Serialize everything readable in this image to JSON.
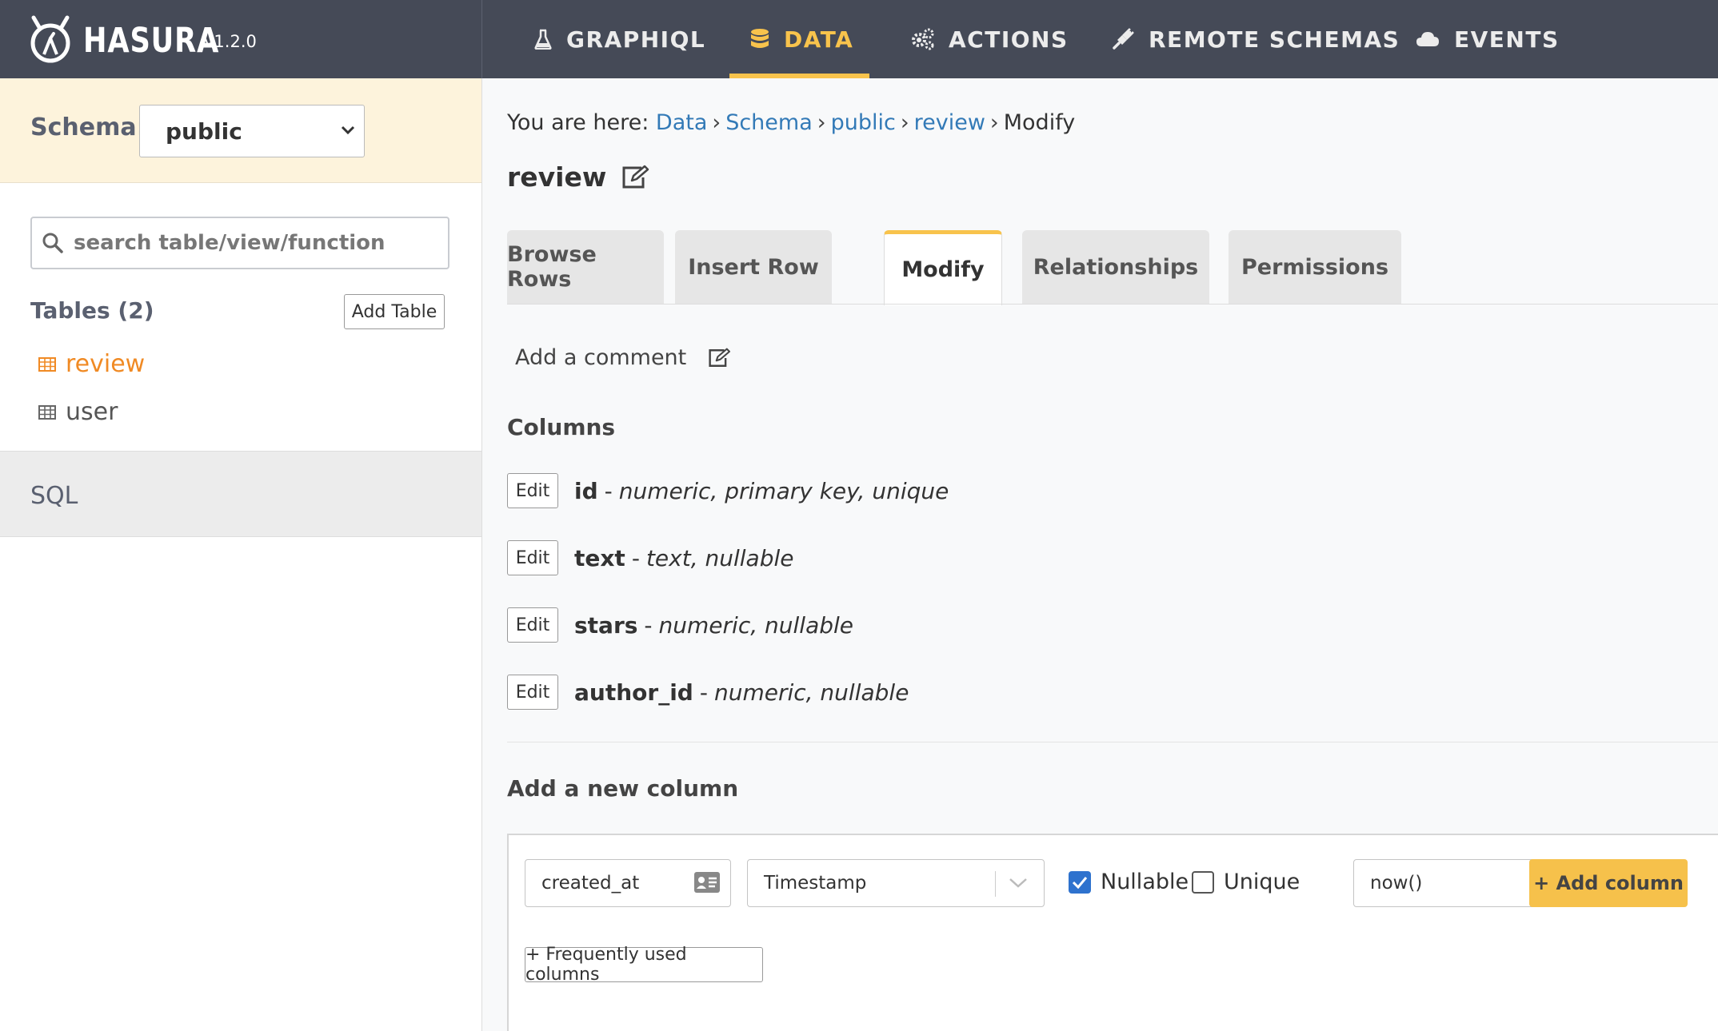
{
  "app": {
    "name": "HASURA",
    "version": "v1.2.0"
  },
  "nav": {
    "items": [
      {
        "label": "GRAPHIQL",
        "icon": "flask-icon"
      },
      {
        "label": "DATA",
        "icon": "database-icon",
        "active": true
      },
      {
        "label": "ACTIONS",
        "icon": "cogs-icon"
      },
      {
        "label": "REMOTE SCHEMAS",
        "icon": "plug-icon"
      },
      {
        "label": "EVENTS",
        "icon": "cloud-icon"
      }
    ]
  },
  "sidebar": {
    "schema_label": "Schema:",
    "schema_value": "public",
    "search_placeholder": "search table/view/function",
    "tables_heading": "Tables (2)",
    "add_table_label": "Add Table",
    "tables": [
      {
        "label": "review",
        "active": true
      },
      {
        "label": "user",
        "active": false
      }
    ],
    "sql_label": "SQL"
  },
  "breadcrumb": {
    "prefix": "You are here:",
    "items": [
      "Data",
      "Schema",
      "public",
      "review",
      "Modify"
    ]
  },
  "page_title": "review",
  "tabs": [
    {
      "label": "Browse Rows"
    },
    {
      "label": "Insert Row"
    },
    {
      "label": "Modify",
      "active": true
    },
    {
      "label": "Relationships"
    },
    {
      "label": "Permissions"
    }
  ],
  "comment_label": "Add a comment",
  "columns_heading": "Columns",
  "columns": [
    {
      "edit": "Edit",
      "name": "id",
      "dash": "-",
      "type": "numeric, primary key, unique"
    },
    {
      "edit": "Edit",
      "name": "text",
      "dash": "-",
      "type": "text, nullable"
    },
    {
      "edit": "Edit",
      "name": "stars",
      "dash": "-",
      "type": "numeric, nullable"
    },
    {
      "edit": "Edit",
      "name": "author_id",
      "dash": "-",
      "type": "numeric, nullable"
    }
  ],
  "new_column": {
    "heading": "Add a new column",
    "name_value": "created_at",
    "type_value": "Timestamp",
    "nullable_label": "Nullable",
    "nullable_checked": true,
    "unique_label": "Unique",
    "unique_checked": false,
    "default_value": "now()",
    "add_button": "+ Add column",
    "frequent_button": "+ Frequently used columns"
  },
  "colors": {
    "nav_bg": "#454a57",
    "accent": "#f8c34c",
    "link": "#337ab7",
    "active_table": "#f08a24"
  }
}
